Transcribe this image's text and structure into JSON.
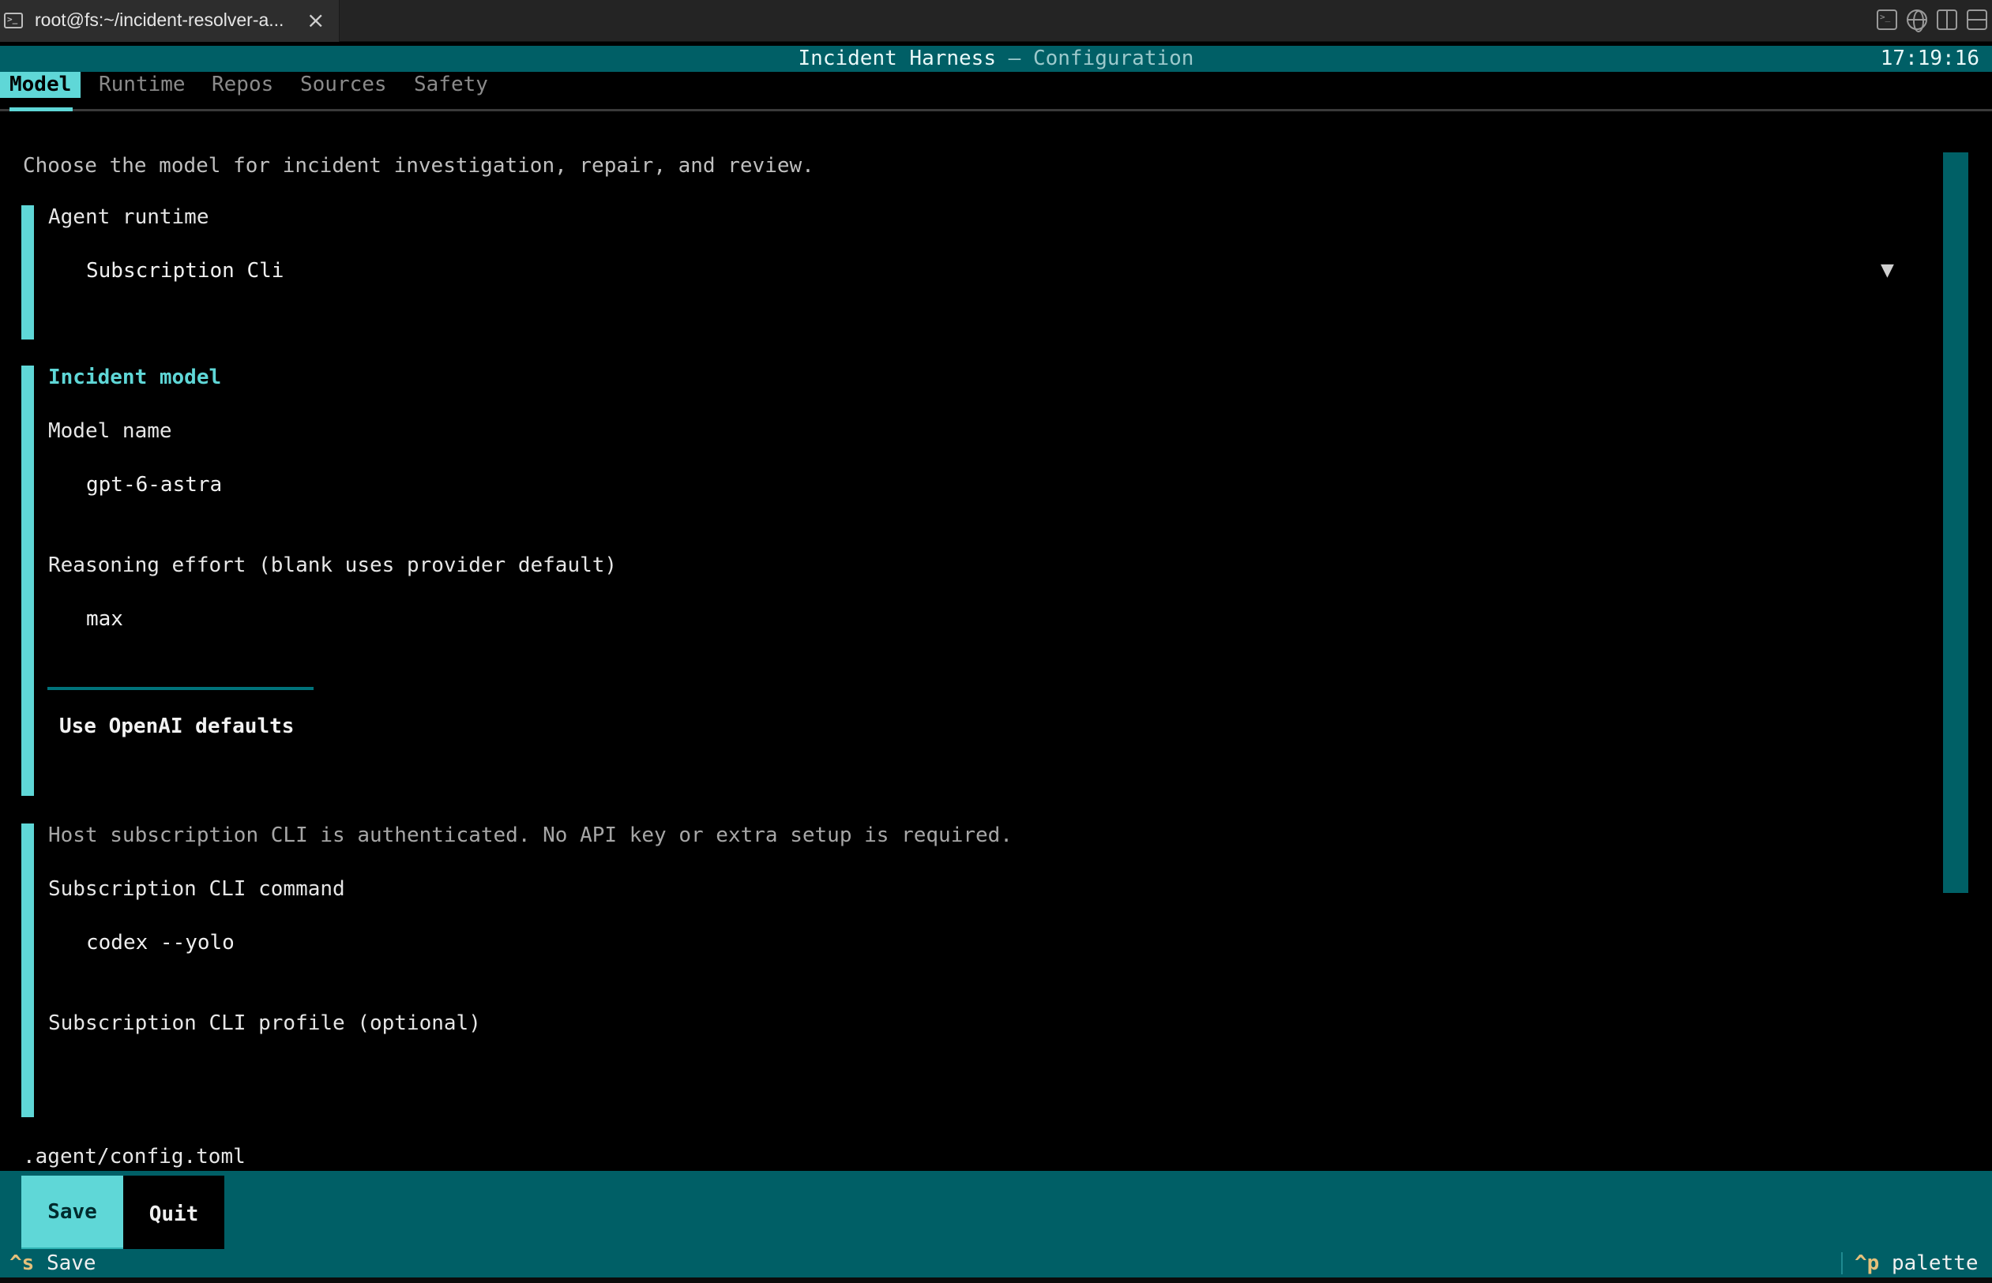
{
  "window": {
    "tab_title": "root@fs:~/incident-resolver-a...",
    "close_glyph": "×"
  },
  "header": {
    "title": "Incident Harness",
    "separator": "—",
    "subtitle": "Configuration",
    "clock": "17:19:16"
  },
  "tabs": [
    {
      "label": "Model",
      "active": true
    },
    {
      "label": "Runtime",
      "active": false
    },
    {
      "label": "Repos",
      "active": false
    },
    {
      "label": "Sources",
      "active": false
    },
    {
      "label": "Safety",
      "active": false
    }
  ],
  "intro": "Choose the model for incident investigation, repair, and review.",
  "agent_runtime": {
    "label": "Agent runtime",
    "value": "Subscription Cli",
    "arrow": "▼"
  },
  "incident_model": {
    "heading": "Incident model",
    "model_name_label": "Model name",
    "model_name_value": "gpt-6-astra",
    "reasoning_label": "Reasoning effort (blank uses provider default)",
    "reasoning_value": "max",
    "defaults_button": "Use OpenAI defaults"
  },
  "subscription": {
    "note": "Host subscription CLI is authenticated. No API key or extra setup is required.",
    "command_label": "Subscription CLI command",
    "command_value": "codex --yolo",
    "profile_label": "Subscription CLI profile (optional)",
    "profile_value": ""
  },
  "config_path": ".agent/config.toml",
  "footer": {
    "save_label": "Save",
    "quit_label": "Quit"
  },
  "keybar": {
    "save_key": "^s",
    "save_desc": "Save",
    "palette_key": "^p",
    "palette_desc": "palette"
  },
  "colors": {
    "accent": "#5fd7d7",
    "header_bg": "#005f66",
    "key_color": "#e5c07b"
  }
}
